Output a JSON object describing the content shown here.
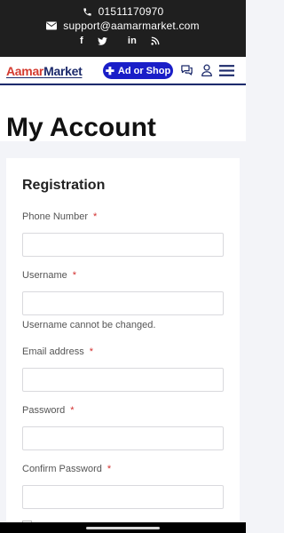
{
  "topbar": {
    "phone": "01511170970",
    "email": "support@aamarmarket.com",
    "social": [
      "facebook-icon",
      "twitter-icon",
      "linkedin-icon",
      "rss-icon"
    ]
  },
  "header": {
    "logo_part1": "Aamar",
    "logo_part2": "Market",
    "ad_button": "Ad or Shop",
    "icons": [
      "chat-icon",
      "user-icon",
      "menu-icon"
    ]
  },
  "page": {
    "title": "My Account"
  },
  "form": {
    "title": "Registration",
    "required_mark": "*",
    "fields": [
      {
        "label": "Phone Number",
        "value": ""
      },
      {
        "label": "Username",
        "value": ""
      },
      {
        "label": "Email address",
        "value": ""
      },
      {
        "label": "Password",
        "value": ""
      },
      {
        "label": "Confirm Password",
        "value": ""
      }
    ],
    "username_hint": "Username cannot be changed."
  },
  "colors": {
    "topbar_bg": "#1f1f1f",
    "brand_blue": "#1a1ec8",
    "logo_red": "#d43a2f",
    "logo_navy": "#1c2a6b",
    "required_red": "#d2302f"
  }
}
